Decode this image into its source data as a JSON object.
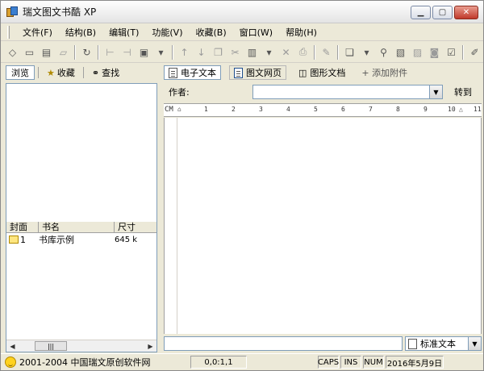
{
  "window": {
    "title": "瑞文图文书酷 XP",
    "controls": [
      "minimize-icon",
      "maximize-icon",
      "close-icon"
    ]
  },
  "menu": [
    "文件(F)",
    "结构(B)",
    "编辑(T)",
    "功能(V)",
    "收藏(B)",
    "窗口(W)",
    "帮助(H)"
  ],
  "left_tabs": [
    {
      "label": "浏览",
      "icon": "",
      "active": true
    },
    {
      "label": "收藏",
      "icon": "star-folder-icon",
      "active": false
    },
    {
      "label": "查找",
      "icon": "binoculars-icon",
      "active": false
    }
  ],
  "book_list": {
    "columns": [
      "封面",
      "书名",
      "尺寸"
    ],
    "rows": [
      {
        "cover": "1",
        "name": "书库示例",
        "size": "645 k"
      }
    ]
  },
  "right_tabs": [
    {
      "label": "电子文本",
      "icon": "document-icon",
      "active": true
    },
    {
      "label": "图文网页",
      "icon": "web-page-icon",
      "active": false
    },
    {
      "label": "图形文档",
      "icon": "graphic-doc-icon",
      "active": false
    },
    {
      "label": "+ 添加附件",
      "icon": "",
      "active": false
    }
  ],
  "author": {
    "label": "作者:",
    "value": "",
    "goto_label": "转到"
  },
  "ruler": {
    "unit": "CM",
    "ticks": [
      "1",
      "2",
      "3",
      "4",
      "5",
      "6",
      "7",
      "8",
      "9",
      "10",
      "11"
    ]
  },
  "style_combo": {
    "value": "标准文本"
  },
  "status": {
    "copyright": "2001-2004 中国瑞文原创软件网",
    "position": "0,0:1,1",
    "caps": "CAPS",
    "ins": "INS",
    "num": "NUM",
    "date": "2016年5月9日"
  }
}
